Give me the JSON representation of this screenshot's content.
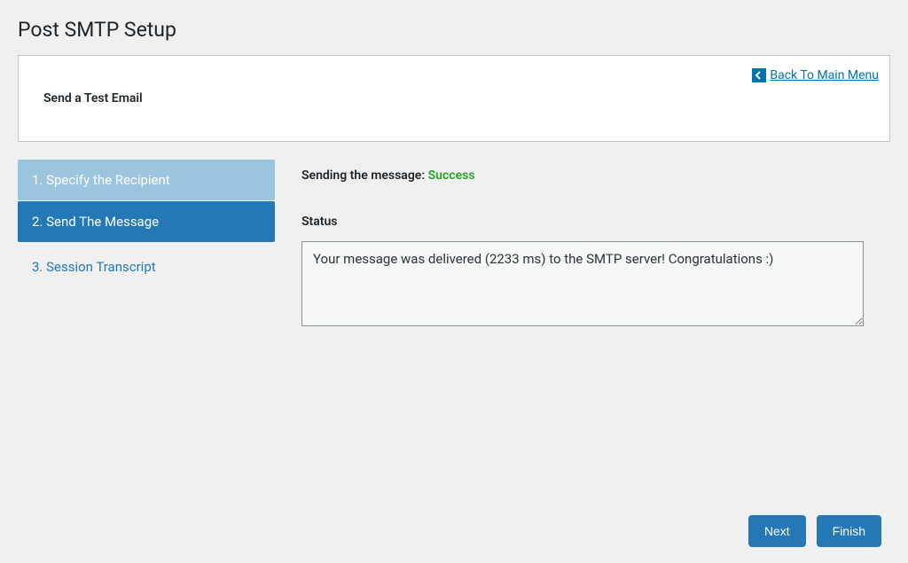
{
  "page_title": "Post SMTP Setup",
  "header": {
    "title": "Send a Test Email",
    "back_link": "Back To Main Menu"
  },
  "steps": {
    "step1": "1. Specify the Recipient",
    "step2": "2. Send The Message",
    "step3": "3. Session Transcript"
  },
  "main": {
    "sending_prefix": "Sending the message: ",
    "sending_status": "Success",
    "status_label": "Status",
    "status_text": "Your message was delivered (2233 ms) to the SMTP server! Congratulations :)"
  },
  "buttons": {
    "next": "Next",
    "finish": "Finish"
  }
}
